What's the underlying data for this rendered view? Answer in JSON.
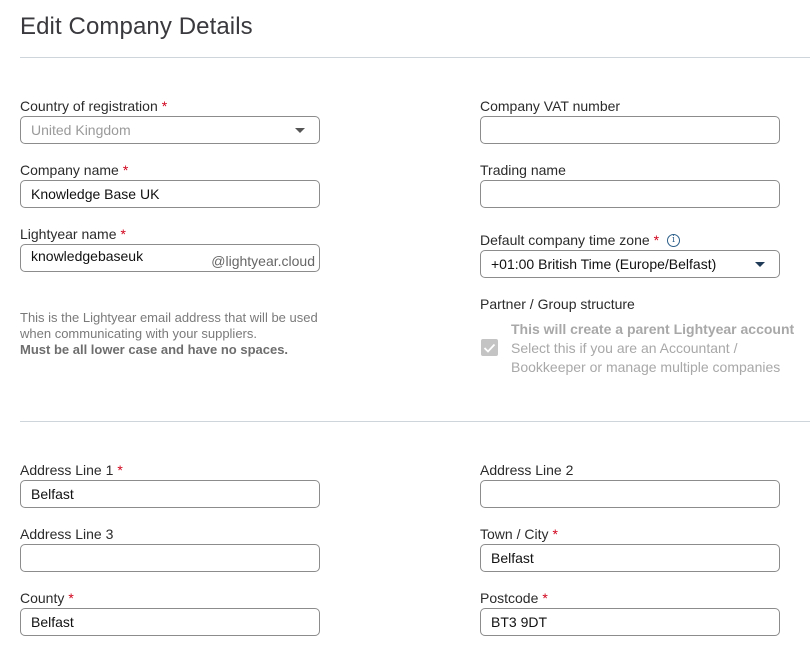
{
  "page": {
    "title": "Edit Company Details"
  },
  "company": {
    "country": {
      "label": "Country of registration",
      "required": "*",
      "value": "United Kingdom"
    },
    "vat": {
      "label": "Company VAT number",
      "value": ""
    },
    "company_name": {
      "label": "Company name",
      "required": "*",
      "value": "Knowledge Base UK"
    },
    "trading_name": {
      "label": "Trading name",
      "value": ""
    },
    "lightyear_name": {
      "label": "Lightyear name",
      "required": "*",
      "value": "knowledgebaseuk",
      "suffix": "@lightyear.cloud"
    },
    "timezone": {
      "label": "Default company time zone",
      "required": "*",
      "value": "+01:00 British Time (Europe/Belfast)",
      "info_icon": "i"
    },
    "help_text": "This is the Lightyear email address that will be used when communicating with your suppliers.",
    "help_bold": "Must be all lower case and have no spaces.",
    "partner": {
      "label": "Partner / Group structure",
      "checked": true,
      "title": "This will create a parent Lightyear account",
      "description": "Select this if you are an Accountant / Bookkeeper or manage multiple companies"
    }
  },
  "address": {
    "line1": {
      "label": "Address Line 1",
      "required": "*",
      "value": "Belfast"
    },
    "line2": {
      "label": "Address Line 2",
      "value": ""
    },
    "line3": {
      "label": "Address Line 3",
      "value": ""
    },
    "city": {
      "label": "Town / City",
      "required": "*",
      "value": "Belfast"
    },
    "county": {
      "label": "County",
      "required": "*",
      "value": "Belfast"
    },
    "postcode": {
      "label": "Postcode",
      "required": "*",
      "value": "BT3 9DT"
    }
  },
  "colors": {
    "required": "#d0021b",
    "divider": "#cfd6db",
    "disabled_text": "#a8a8a8"
  }
}
